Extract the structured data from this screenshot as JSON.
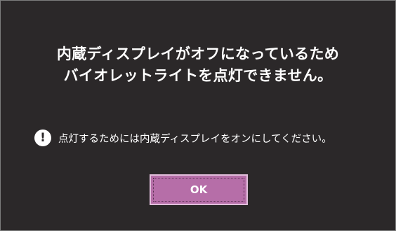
{
  "dialog": {
    "title_line1": "内蔵ディスプレイがオフになっているため",
    "title_line2": "バイオレットライトを点灯できません。",
    "notice": {
      "icon": "exclamation-circle-icon",
      "icon_glyph": "!",
      "text": "点灯するためには内蔵ディスプレイをオンにしてください。"
    },
    "ok_label": "OK"
  },
  "colors": {
    "background": "#2b2829",
    "accent": "#b66ea8",
    "text": "#ffffff"
  }
}
